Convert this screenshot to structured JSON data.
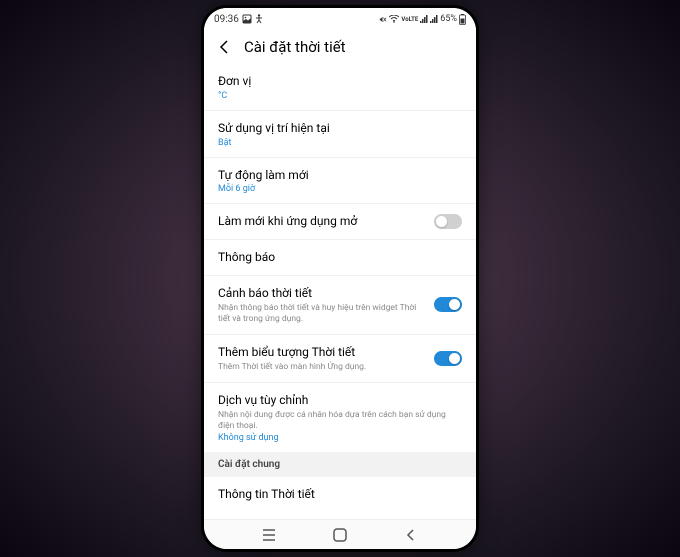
{
  "status": {
    "time": "09:36",
    "battery": "65%"
  },
  "header": {
    "title": "Cài đặt thời tiết"
  },
  "settings": {
    "unit": {
      "title": "Đơn vị",
      "value": "°C"
    },
    "location": {
      "title": "Sử dụng vị trí hiện tại",
      "value": "Bật"
    },
    "refresh": {
      "title": "Tự động làm mới",
      "value": "Mỗi 6 giờ"
    },
    "refreshOnOpen": {
      "title": "Làm mới khi ứng dụng mở"
    },
    "notifications": {
      "title": "Thông báo"
    },
    "weatherAlert": {
      "title": "Cảnh báo thời tiết",
      "desc": "Nhận thông báo thời tiết và huy hiệu trên widget Thời tiết và trong ứng dụng."
    },
    "addIcon": {
      "title": "Thêm biểu tượng Thời tiết",
      "desc": "Thêm Thời tiết vào màn hình Ứng dụng."
    },
    "customService": {
      "title": "Dịch vụ tùy chỉnh",
      "desc": "Nhận nội dung được cá nhân hóa dựa trên cách bạn sử dụng điện thoại.",
      "value": "Không sử dụng"
    }
  },
  "sections": {
    "general": "Cài đặt chung"
  },
  "info": {
    "weatherInfo": "Thông tin Thời tiết"
  }
}
